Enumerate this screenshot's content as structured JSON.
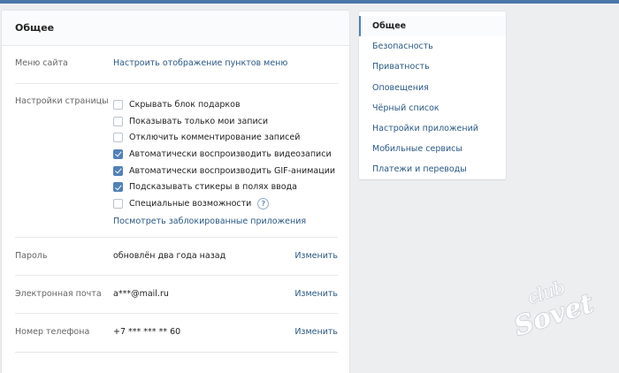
{
  "card": {
    "title": "Общее"
  },
  "site_menu": {
    "label": "Меню сайта",
    "link": "Настроить отображение пунктов меню"
  },
  "page_settings": {
    "label": "Настройки страницы",
    "options": [
      {
        "label": "Скрывать блок подарков",
        "checked": false
      },
      {
        "label": "Показывать только мои записи",
        "checked": false
      },
      {
        "label": "Отключить комментирование записей",
        "checked": false
      },
      {
        "label": "Автоматически воспроизводить видеозаписи",
        "checked": true
      },
      {
        "label": "Автоматически воспроизводить GIF-анимации",
        "checked": true
      },
      {
        "label": "Подсказывать стикеры в полях ввода",
        "checked": true
      },
      {
        "label": "Специальные возможности",
        "checked": false
      }
    ],
    "help_glyph": "?",
    "blocked_apps_link": "Посмотреть заблокированные приложения"
  },
  "password": {
    "label": "Пароль",
    "value": "обновлён два года назад",
    "edit": "Изменить"
  },
  "email": {
    "label": "Электронная почта",
    "value": "a***@mail.ru",
    "edit": "Изменить"
  },
  "phone": {
    "label": "Номер телефона",
    "value": "+7 *** *** ** 60",
    "edit": "Изменить"
  },
  "nav": {
    "items": [
      {
        "label": "Общее",
        "active": true
      },
      {
        "label": "Безопасность",
        "active": false
      },
      {
        "label": "Приватность",
        "active": false
      },
      {
        "label": "Оповещения",
        "active": false
      },
      {
        "label": "Чёрный список",
        "active": false
      },
      {
        "label": "Настройки приложений",
        "active": false
      },
      {
        "label": "Мобильные сервисы",
        "active": false
      },
      {
        "label": "Платежи и переводы",
        "active": false
      }
    ]
  },
  "watermark": {
    "line1": "club",
    "line2": "Sovet"
  },
  "colors": {
    "accent": "#5181b8",
    "link": "#2a5885",
    "background": "#edeef0"
  }
}
